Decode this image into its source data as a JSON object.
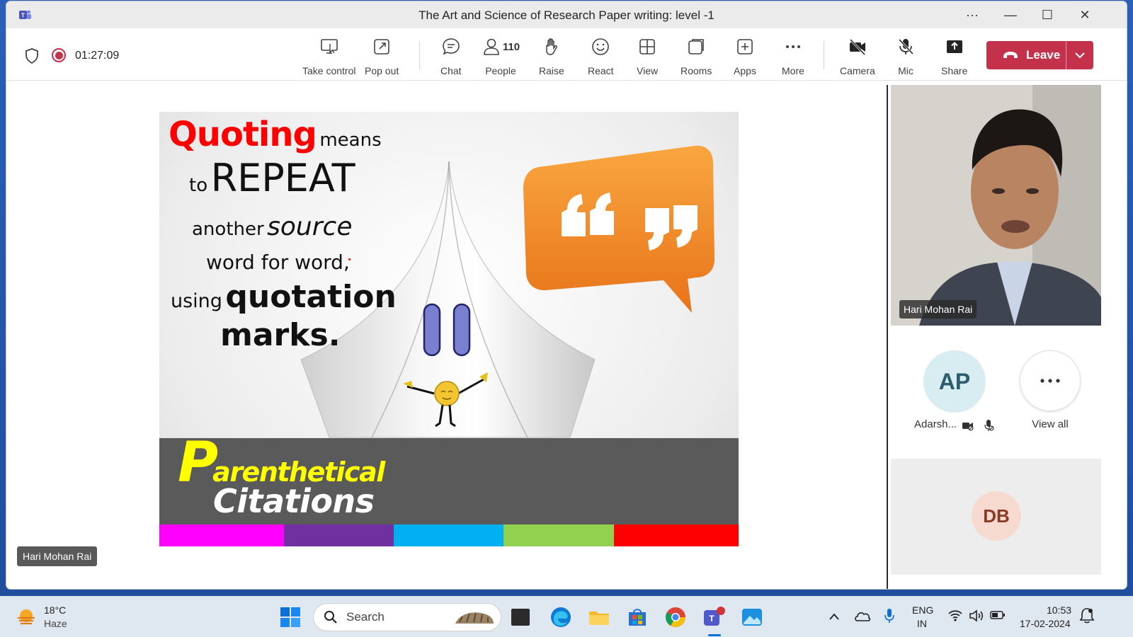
{
  "window": {
    "title": "The Art and Science of Research Paper writing: level -1",
    "controls": [
      "···",
      "—",
      "☐",
      "✕"
    ]
  },
  "toolbar": {
    "timer": "01:27:09",
    "buttons": [
      {
        "label": "Take control",
        "icon": "take-control-icon"
      },
      {
        "label": "Pop out",
        "icon": "pop-out-icon"
      },
      {
        "label": "Chat",
        "icon": "chat-icon"
      },
      {
        "label": "People",
        "icon": "people-icon",
        "count": "110"
      },
      {
        "label": "Raise",
        "icon": "raise-hand-icon"
      },
      {
        "label": "React",
        "icon": "react-icon"
      },
      {
        "label": "View",
        "icon": "view-icon"
      },
      {
        "label": "Rooms",
        "icon": "rooms-icon"
      },
      {
        "label": "Apps",
        "icon": "apps-icon"
      },
      {
        "label": "More",
        "icon": "more-icon"
      },
      {
        "label": "Camera",
        "icon": "camera-off-icon"
      },
      {
        "label": "Mic",
        "icon": "mic-off-icon"
      },
      {
        "label": "Share",
        "icon": "share-icon"
      }
    ],
    "leave_label": "Leave"
  },
  "slide": {
    "line1_big": "Quoting",
    "line1_small": "means",
    "line2_small": "to",
    "line2_big": "REPEAT",
    "line3_a": "another",
    "line3_b": "source",
    "line4": "word for word,",
    "line5_a": "using",
    "line5_b": "quotation",
    "line6": "marks.",
    "footer_p": "P",
    "footer_rest": "arenthetical",
    "footer_line2": "Citations",
    "colors": [
      "#ff00ff",
      "#7030a0",
      "#00b0f0",
      "#92d050",
      "#ff0000"
    ],
    "accent_red": "#ff0000",
    "bubble_orange": "#f28a1d",
    "footer_yellow": "#ffff00"
  },
  "stage": {
    "presenter_name": "Hari Mohan Rai"
  },
  "panel": {
    "video_name": "Hari Mohan Rai",
    "participant_initials": "AP",
    "participant_name": "Adarsh...",
    "view_all_label": "View all",
    "tile_initials": "DB"
  },
  "taskbar": {
    "weather_temp": "18°C",
    "weather_desc": "Haze",
    "search_label": "Search",
    "lang_line1": "ENG",
    "lang_line2": "IN",
    "time": "10:53",
    "date": "17-02-2024"
  }
}
